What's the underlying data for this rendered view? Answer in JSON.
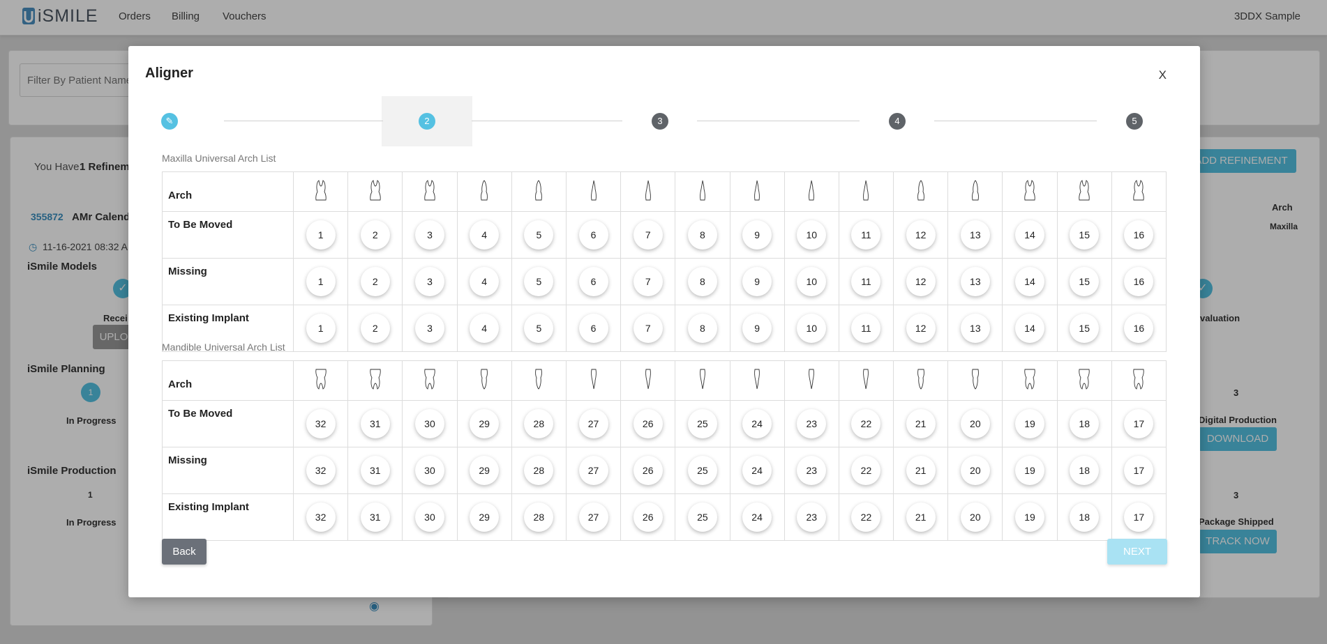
{
  "app": {
    "logo": "iSMILE",
    "nav": [
      "Orders",
      "Billing",
      "Vouchers"
    ],
    "user": "3DDX Sample"
  },
  "background": {
    "filter_placeholder": "Filter By Patient Name",
    "refinement_text": "You Have",
    "refinement_count": "1 Refineme",
    "add_refinement": "ADD REFINEMENT",
    "patient_id": "355872",
    "patient_name": "AMr Calendl",
    "date": "11-16-2021 08:32 AM",
    "models_title": "iSmile Models",
    "received": "Recei",
    "upload": "UPLO",
    "planning_title": "iSmile Planning",
    "planning_step": "1",
    "planning_status": "In Progress",
    "production_title": "iSmile Production",
    "production_step": "1",
    "production_status": "In Progress",
    "arch_header": "Arch",
    "arch_value": "Maxilla",
    "evaluation": "valuation",
    "step3_a": "3",
    "digital_production": "Digital Production",
    "download": "DOWNLOAD",
    "step3_b": "3",
    "package_shipped": "Package Shipped",
    "track_now": "TRACK NOW"
  },
  "modal": {
    "title": "Aligner",
    "close": "X",
    "steps": [
      {
        "label": "✎",
        "state": "done"
      },
      {
        "label": "2",
        "state": "current"
      },
      {
        "label": "3",
        "state": "todo"
      },
      {
        "label": "4",
        "state": "todo"
      },
      {
        "label": "5",
        "state": "todo"
      }
    ],
    "maxilla": {
      "title": "Maxilla Universal Arch List",
      "arch_label": "Arch",
      "rows": [
        "To Be Moved",
        "Missing",
        "Existing Implant"
      ],
      "teeth": [
        "1",
        "2",
        "3",
        "4",
        "5",
        "6",
        "7",
        "8",
        "9",
        "10",
        "11",
        "12",
        "13",
        "14",
        "15",
        "16"
      ]
    },
    "mandible": {
      "title": "Mandible Universal Arch List",
      "arch_label": "Arch",
      "rows": [
        "To Be Moved",
        "Missing",
        "Existing Implant"
      ],
      "teeth": [
        "32",
        "31",
        "30",
        "29",
        "28",
        "27",
        "26",
        "25",
        "24",
        "23",
        "22",
        "21",
        "20",
        "19",
        "18",
        "17"
      ]
    },
    "back_label": "Back",
    "next_label": "NEXT"
  },
  "colors": {
    "accent": "#55c1e2",
    "step_todo": "#5f6368",
    "back_button": "#6b7079",
    "next_button_disabled": "#a9e2f3"
  }
}
